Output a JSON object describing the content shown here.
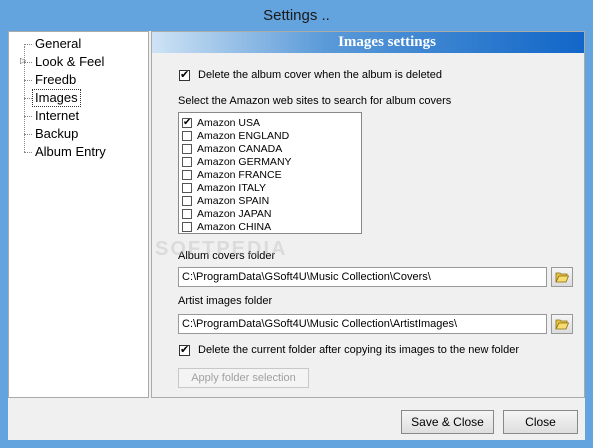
{
  "window": {
    "title": "Settings .."
  },
  "tree": {
    "items": [
      {
        "label": "General",
        "expandable": false,
        "selected": false
      },
      {
        "label": "Look & Feel",
        "expandable": true,
        "selected": false
      },
      {
        "label": "Freedb",
        "expandable": false,
        "selected": false
      },
      {
        "label": "Images",
        "expandable": false,
        "selected": true
      },
      {
        "label": "Internet",
        "expandable": false,
        "selected": false
      },
      {
        "label": "Backup",
        "expandable": false,
        "selected": false
      },
      {
        "label": "Album Entry",
        "expandable": false,
        "selected": false
      }
    ]
  },
  "panel": {
    "header": "Images settings",
    "delete_cover": {
      "label": "Delete the album cover when the album is deleted",
      "checked": true
    },
    "amazon_label": "Select the Amazon web sites to search for album covers",
    "amazon_sites": [
      {
        "label": "Amazon USA",
        "checked": true
      },
      {
        "label": "Amazon ENGLAND",
        "checked": false
      },
      {
        "label": "Amazon CANADA",
        "checked": false
      },
      {
        "label": "Amazon GERMANY",
        "checked": false
      },
      {
        "label": "Amazon FRANCE",
        "checked": false
      },
      {
        "label": "Amazon ITALY",
        "checked": false
      },
      {
        "label": "Amazon SPAIN",
        "checked": false
      },
      {
        "label": "Amazon JAPAN",
        "checked": false
      },
      {
        "label": "Amazon CHINA",
        "checked": false
      }
    ],
    "covers_folder_label": "Album covers folder",
    "covers_folder_value": "C:\\ProgramData\\GSoft4U\\Music Collection\\Covers\\",
    "artist_folder_label": "Artist images folder",
    "artist_folder_value": "C:\\ProgramData\\GSoft4U\\Music Collection\\ArtistImages\\",
    "delete_folder": {
      "label": "Delete the current folder after copying its images to the new folder",
      "checked": true
    },
    "apply_button": "Apply folder selection"
  },
  "footer": {
    "save_close": "Save & Close",
    "close": "Close"
  },
  "watermark": "SOFTPEDIA",
  "colors": {
    "title_bg": "#63a3de",
    "header_accent": "#1166c8"
  }
}
